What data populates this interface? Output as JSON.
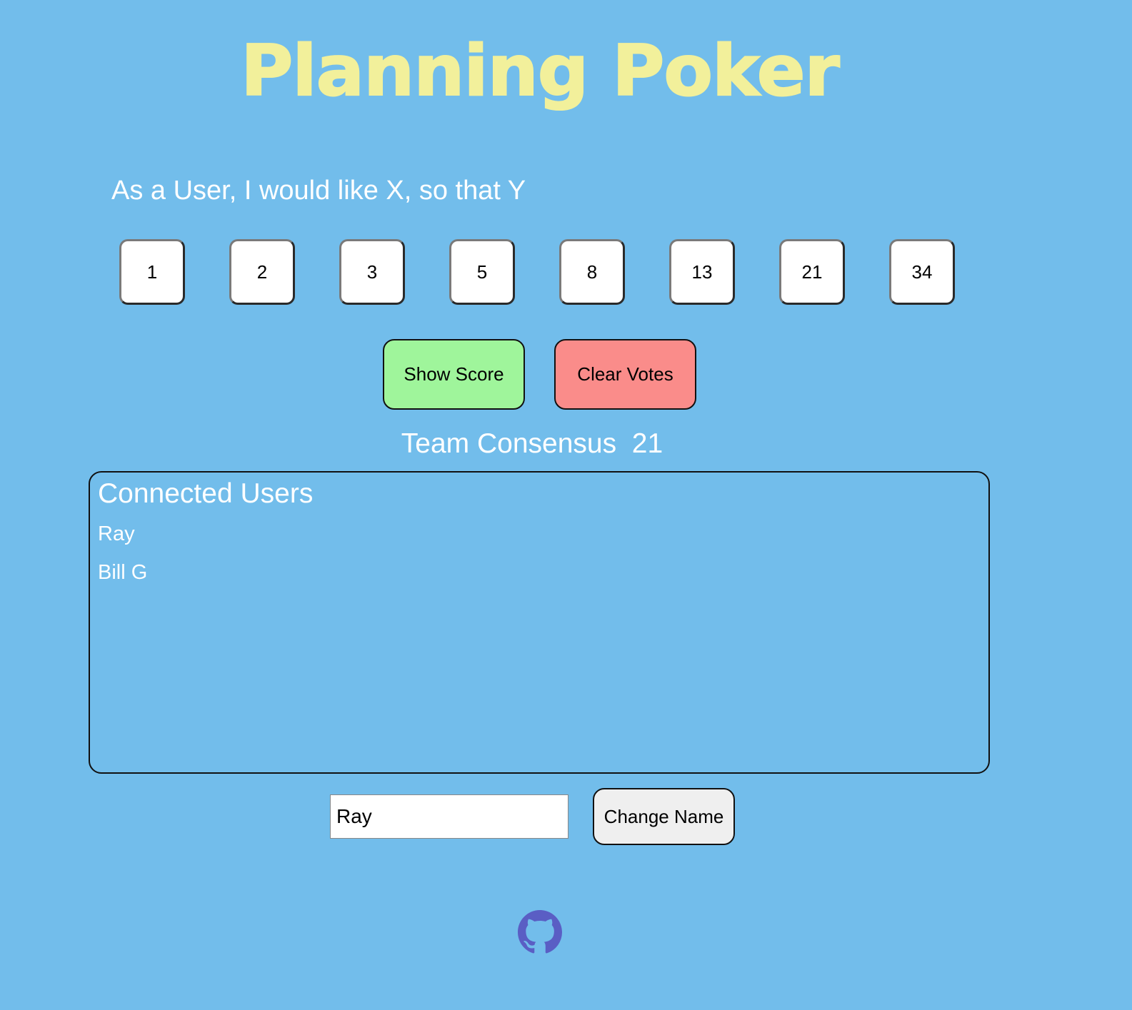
{
  "title": "Planning Poker",
  "story": "As a User, I would like X, so that Y",
  "cards": [
    "1",
    "2",
    "3",
    "5",
    "8",
    "13",
    "21",
    "34"
  ],
  "actions": {
    "show_score": "Show Score",
    "clear_votes": "Clear Votes"
  },
  "consensus": {
    "label": "Team Consensus",
    "value": "21"
  },
  "users_panel": {
    "title": "Connected Users",
    "users": [
      "Ray",
      "Bill G"
    ]
  },
  "name_form": {
    "value": "Ray",
    "button": "Change Name"
  },
  "footer": {
    "icon": "github-icon"
  },
  "colors": {
    "background": "#72bdeb",
    "title": "#f2f09b",
    "show_score": "#9ff59b",
    "clear_votes": "#fa8c8a",
    "change_name": "#efefef",
    "github": "#5a5ec4"
  }
}
